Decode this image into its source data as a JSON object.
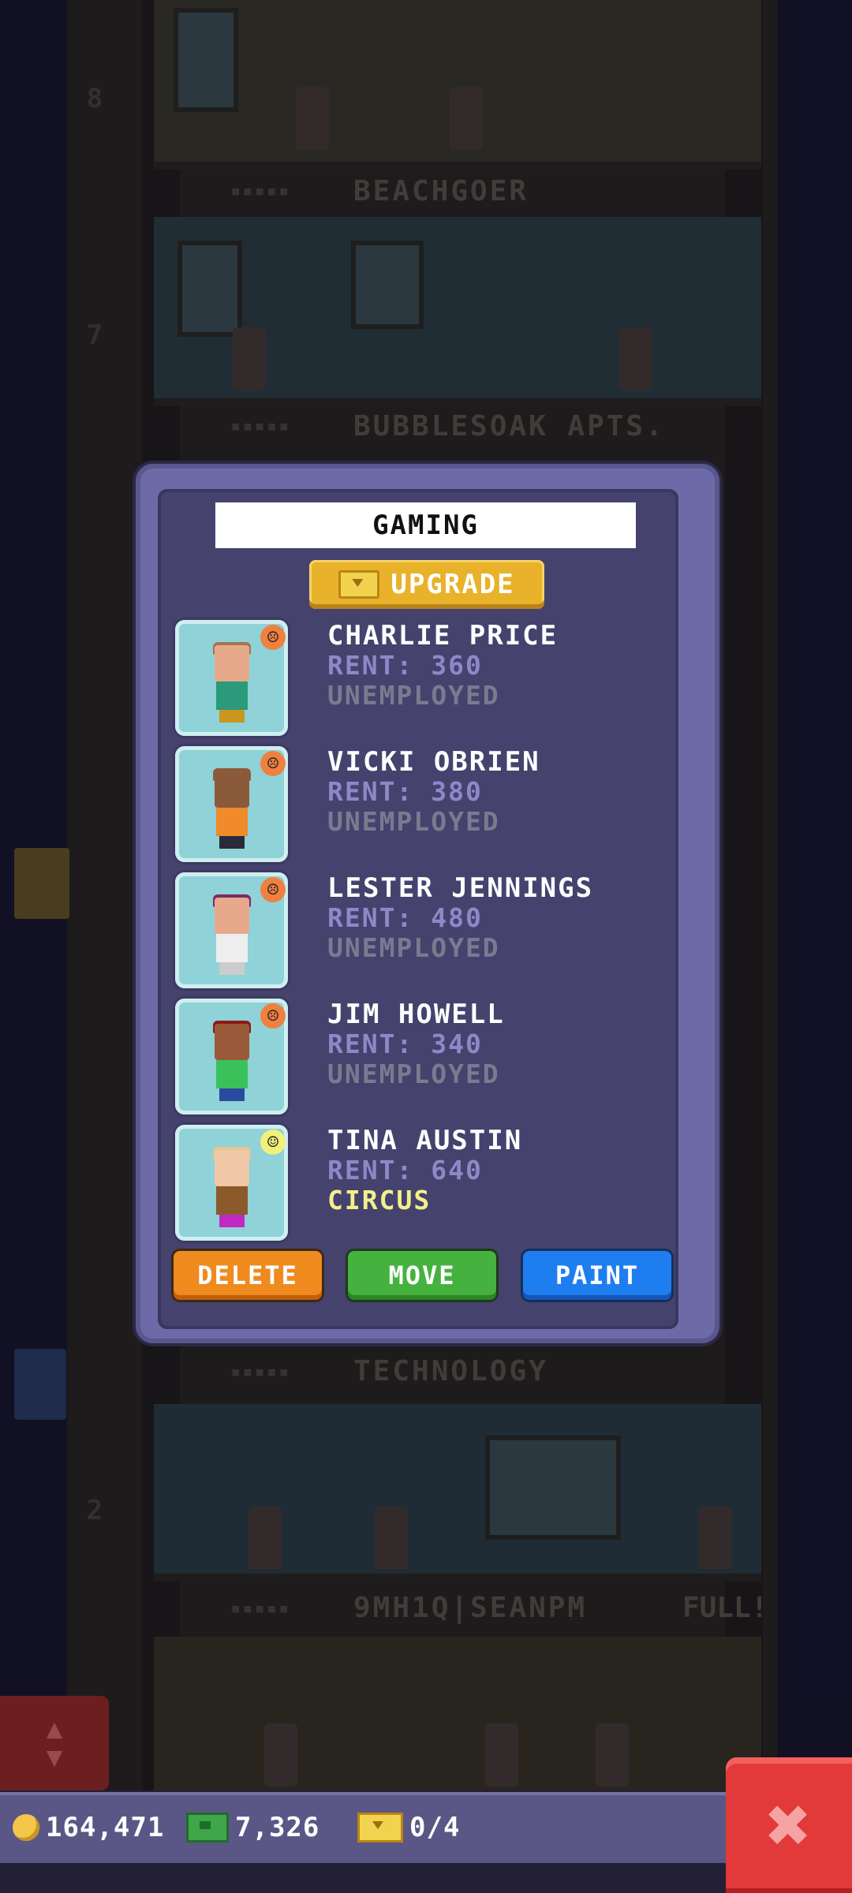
{
  "background": {
    "floors": [
      {
        "label": "BEACHGOER",
        "number": "8"
      },
      {
        "label": "BUBBLESOAK APTS.",
        "number": "7"
      },
      {
        "label": "TECHNOLOGY",
        "number": "2"
      },
      {
        "label": "9MH1Q|SEANPM",
        "number": ""
      }
    ],
    "full_tag": "FULL!",
    "floor_dots": "▪▪▪▪▪"
  },
  "dialog": {
    "floor_name_value": "GAMING",
    "upgrade_label": "UPGRADE",
    "residents": [
      {
        "name": "CHARLIE PRICE",
        "rent": "RENT: 360",
        "job": "UNEMPLOYED",
        "mood": "sad",
        "mood_glyph": "☹",
        "skin": "#e7a98a",
        "hair": "#a07850",
        "shirt": "#2a9a7a",
        "legs": "#c9961e"
      },
      {
        "name": "VICKI OBRIEN",
        "rent": "RENT: 380",
        "job": "UNEMPLOYED",
        "mood": "sad",
        "mood_glyph": "☹",
        "skin": "#8a5a3a",
        "hair": "#8a5a3a",
        "shirt": "#f08a2a",
        "legs": "#2a2a3a"
      },
      {
        "name": "LESTER JENNINGS",
        "rent": "RENT: 480",
        "job": "UNEMPLOYED",
        "mood": "sad",
        "mood_glyph": "☹",
        "skin": "#e7a98a",
        "hair": "#7a2a6a",
        "shirt": "#eeeeee",
        "legs": "#cccccc"
      },
      {
        "name": "JIM HOWELL",
        "rent": "RENT: 340",
        "job": "UNEMPLOYED",
        "mood": "sad",
        "mood_glyph": "☹",
        "skin": "#9a5a3a",
        "hair": "#8a1a1a",
        "shirt": "#3ac25a",
        "legs": "#2a4aa0"
      },
      {
        "name": "TINA AUSTIN",
        "rent": "RENT: 640",
        "job": "CIRCUS",
        "mood": "neutral",
        "mood_glyph": "☺",
        "skin": "#f0c8a8",
        "hair": "#e0c890",
        "shirt": "#8a5a2a",
        "legs": "#c02ac0"
      }
    ],
    "actions": {
      "delete": "DELETE",
      "move": "MOVE",
      "paint": "PAINT"
    }
  },
  "hud": {
    "coins": "164,471",
    "cash": "7,326",
    "bux": "0/4",
    "close_glyph": "✖",
    "elevator_glyph": "▲\n▼"
  },
  "colors": {
    "panel": "#6d6aa8",
    "panel_inner": "#45426e",
    "upgrade": "#e8b22b",
    "delete": "#ef8a1f",
    "move": "#45b23f",
    "paint": "#1e7ef0",
    "close": "#e23a3a"
  }
}
